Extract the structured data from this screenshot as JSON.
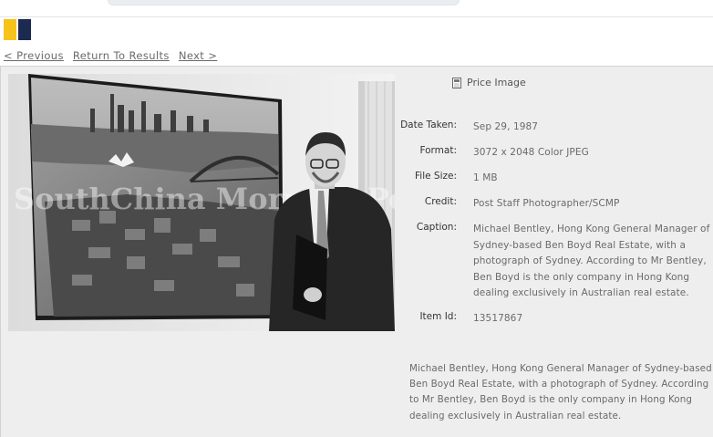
{
  "nav": {
    "previous": "< Previous",
    "return_to_results": "Return To Results",
    "next": "Next >"
  },
  "price_image_label": "Price Image",
  "image": {
    "watermark": "SouthChina Morning Post"
  },
  "details": {
    "date_taken": {
      "label": "Date Taken:",
      "value": "Sep 29, 1987"
    },
    "format": {
      "label": "Format:",
      "value": "3072 x 2048 Color JPEG"
    },
    "file_size": {
      "label": "File Size:",
      "value": "1 MB"
    },
    "credit": {
      "label": "Credit:",
      "value": "Post Staff Photographer/SCMP"
    },
    "caption": {
      "label": "Caption:",
      "value": "Michael Bentley, Hong Kong General Manager of Sydney-based Ben Boyd Real Estate, with a photograph of Sydney. According to Mr Bentley, Ben Boyd is the only company in Hong Kong dealing exclusively in Australian real estate."
    },
    "item_id": {
      "label": "Item Id:",
      "value": "13517867"
    }
  },
  "description": "Michael Bentley, Hong Kong General Manager of Sydney-based Ben Boyd Real Estate, with a photograph of Sydney. According to Mr Bentley, Ben Boyd is the only company in Hong Kong dealing exclusively in Australian real estate.",
  "colors": {
    "logo_yellow": "#f6c31b",
    "logo_navy": "#1b2a4e",
    "panel_bg": "#eeeeee"
  }
}
